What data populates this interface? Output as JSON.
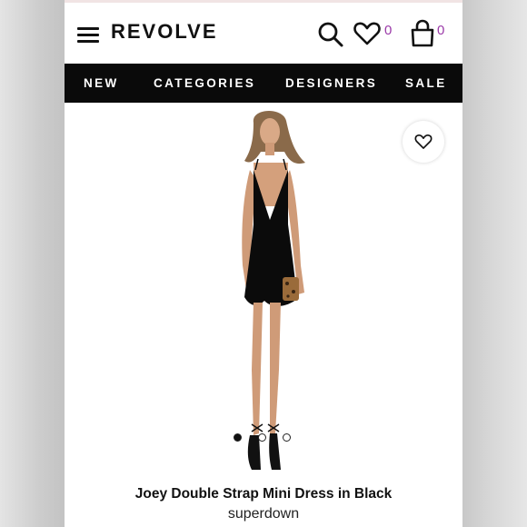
{
  "header": {
    "logo": "REVOLVE",
    "wishlist_count": "0",
    "cart_count": "0"
  },
  "nav": {
    "items": [
      "NEW",
      "CATEGORIES",
      "DESIGNERS",
      "SALE"
    ]
  },
  "carousel": {
    "current_index": 1,
    "total": 3
  },
  "product": {
    "title": "Joey Double Strap Mini Dress in Black",
    "brand": "superdown"
  },
  "colors": {
    "nav_bg": "#0a0a0a",
    "count_accent": "#9b3aa8",
    "text": "#111111"
  },
  "icons": [
    "menu-icon",
    "search-icon",
    "heart-icon",
    "shopping-bag-icon",
    "heart-outline-icon"
  ]
}
